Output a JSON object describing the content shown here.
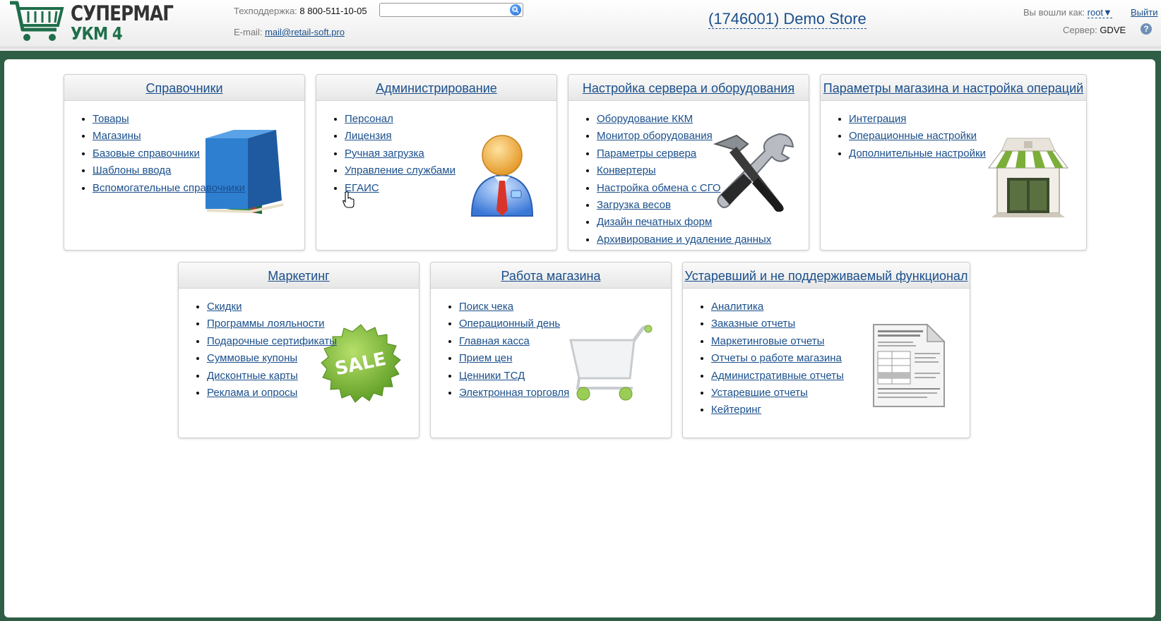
{
  "header": {
    "logo_line1": "СУПЕРМАГ",
    "logo_line2": "УКМ 4",
    "support_label": "Техподдержка:",
    "support_phone": "8 800-511-10-05",
    "email_label": "E-mail:",
    "email": "mail@retail-soft.pro",
    "search_placeholder": "",
    "store_title": "(1746001) Demo Store",
    "logged_in_label": "Вы вошли как:",
    "user": "root▼",
    "logout": "Выйти",
    "server_label": "Сервер:",
    "server": "GDVE",
    "help": "?"
  },
  "panels": [
    {
      "title": "Справочники",
      "icon": "books-icon",
      "items": [
        "Товары",
        "Магазины",
        "Базовые справочники",
        "Шаблоны ввода",
        "Вспомогательные справочники"
      ]
    },
    {
      "title": "Администрирование",
      "icon": "admin-user-icon",
      "items": [
        "Персонал",
        "Лицензия",
        "Ручная загрузка",
        "Управление службами",
        "ЕГАИС"
      ]
    },
    {
      "title": "Настройка сервера и оборудования",
      "icon": "tools-icon",
      "items": [
        "Оборудование ККМ",
        "Монитор оборудования",
        "Параметры сервера",
        "Конвертеры",
        "Настройка обмена с СГО",
        "Загрузка весов",
        "Дизайн печатных форм",
        "Архивирование и удаление данных"
      ]
    },
    {
      "title": "Параметры магазина и настройка операций",
      "icon": "shop-icon",
      "items": [
        "Интеграция",
        "Операционные настройки",
        "Дополнительные настройки"
      ]
    },
    {
      "title": "Маркетинг",
      "icon": "sale-badge-icon",
      "badge_text": "SALE",
      "items": [
        "Скидки",
        "Программы лояльности",
        "Подарочные сертификаты",
        "Суммовые купоны",
        "Дисконтные карты",
        "Реклама и опросы"
      ]
    },
    {
      "title": "Работа магазина",
      "icon": "shopping-cart-icon",
      "items": [
        "Поиск чека",
        "Операционный день",
        "Главная касса",
        "Прием цен",
        "Ценники ТСД",
        "Электронная торговля"
      ]
    },
    {
      "title": "Устаревший и не поддерживаемый функционал",
      "icon": "document-icon",
      "items": [
        "Аналитика",
        "Заказные отчеты",
        "Маркетинговые отчеты",
        "Отчеты о работе магазина",
        "Административные отчеты",
        "Устаревшие отчеты",
        "Кейтеринг"
      ]
    }
  ],
  "colors": {
    "background": "#2e5e45",
    "link": "#1a4f8c",
    "brand_green": "#1f6e4a"
  }
}
